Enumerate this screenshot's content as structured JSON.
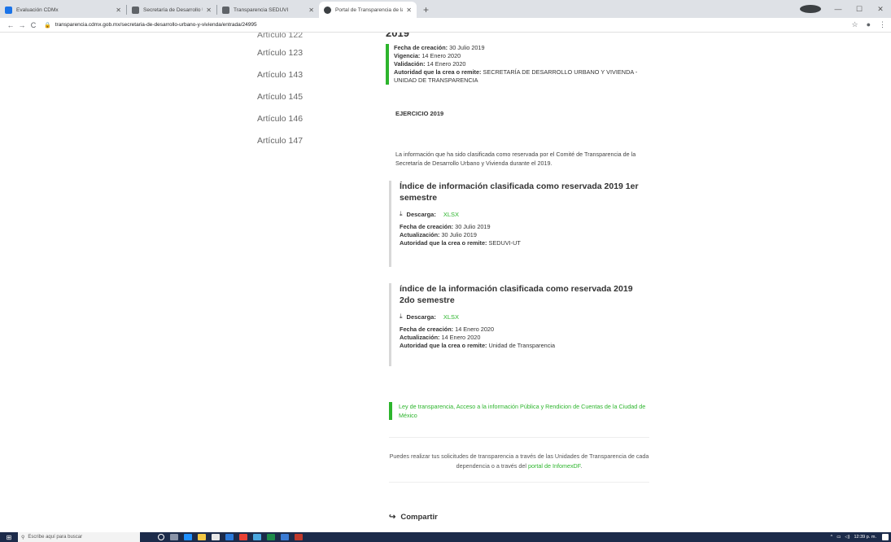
{
  "browser": {
    "tabs": [
      {
        "label": "Evaluación CDMx",
        "color": "#1a73e8",
        "active": false
      },
      {
        "label": "Secretaría de Desarrollo Urbano",
        "color": "#5f6368",
        "active": false
      },
      {
        "label": "Transparencia SEDUVI",
        "color": "#5f6368",
        "active": false
      },
      {
        "label": "Portal de Transparencia de la CDMX",
        "color": "#3c4043",
        "active": true
      }
    ],
    "new_tab": "+",
    "url": "transparencia.cdmx.gob.mx/secretaria-de-desarrollo-urbano-y-vivienda/entrada/24995"
  },
  "sidebar": {
    "items": [
      {
        "label": "Artículo 122"
      },
      {
        "label": "Artículo 123"
      },
      {
        "label": "Artículo 143"
      },
      {
        "label": "Artículo 145"
      },
      {
        "label": "Artículo 146"
      },
      {
        "label": "Artículo 147"
      }
    ]
  },
  "main": {
    "year_heading": "2019",
    "meta": {
      "creacion_label": "Fecha de creación:",
      "creacion_value": "30 Julio 2019",
      "vigencia_label": "Vigencia:",
      "vigencia_value": "14 Enero 2020",
      "validacion_label": "Validación:",
      "validacion_value": "14 Enero 2020",
      "autoridad_label": "Autoridad que la crea o remite:",
      "autoridad_value": "SECRETARÍA DE DESARROLLO URBANO Y VIVIENDA - UNIDAD DE TRANSPARENCIA"
    },
    "ejercicio": "EJERCICIO 2019",
    "description": "La información que ha sido clasificada como reservada por el Comité de Transparencia de la Secretaría de Desarrollo Urbano y Vivienda durante el 2019.",
    "documents": [
      {
        "title": "Índice de información clasificada como reservada 2019 1er semestre",
        "download_label": "Descarga:",
        "download_format": "XLSX",
        "creacion_label": "Fecha de creación:",
        "creacion_value": "30 Julio 2019",
        "actualizacion_label": "Actualización:",
        "actualizacion_value": "30 Julio 2019",
        "autoridad_label": "Autoridad que la crea o remite:",
        "autoridad_value": "SEDUVI-UT"
      },
      {
        "title": "índice de la información clasificada como reservada 2019 2do semestre",
        "download_label": "Descarga:",
        "download_format": "XLSX",
        "creacion_label": "Fecha de creación:",
        "creacion_value": "14 Enero 2020",
        "actualizacion_label": "Actualización:",
        "actualizacion_value": "14 Enero 2020",
        "autoridad_label": "Autoridad que la crea o remite:",
        "autoridad_value": "Unidad de Transparencia"
      }
    ],
    "law_link": "Ley de transparencia, Acceso a la información Pública y Rendicion de Cuentas de la Ciudad de México",
    "solicitudes_text": "Puedes realizar tus solicitudes de transparencia a través de las Unidades de Transparencia de cada dependencia o a través del",
    "solicitudes_link": "portal de InfomexDF",
    "solicitudes_end": ".",
    "share_label": "Compartir"
  },
  "taskbar": {
    "search_placeholder": "Escribe aquí para buscar",
    "time": "12:39 p. m."
  },
  "colors": {
    "accent_green": "#2db52d",
    "taskbar_bg": "#1c2b4a"
  }
}
